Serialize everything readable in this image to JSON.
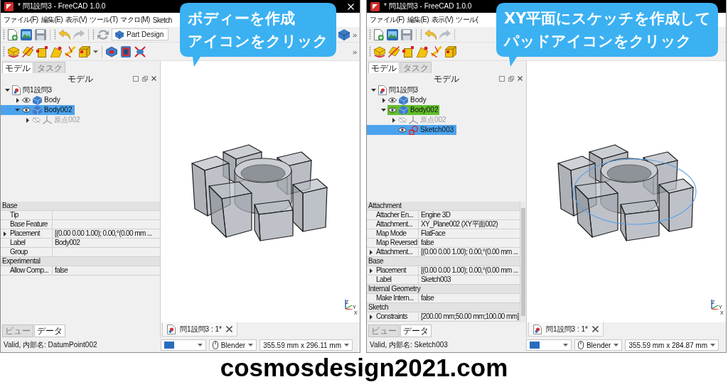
{
  "windows": [
    {
      "title": "* 問1設問3 - FreeCAD 1.0.0",
      "menu": [
        "ファイル(F)",
        "編集(E)",
        "表示(V)",
        "ツール(T)",
        "マクロ(M)",
        "Sketch"
      ],
      "workbench": "Part Design",
      "toolbar_overflow": [
        "»",
        "»"
      ],
      "callout": {
        "lines": [
          "ボディーを作成",
          "アイコンをクリック"
        ]
      },
      "panel_tabs": [
        {
          "label": "モデル",
          "selected": true
        },
        {
          "label": "タスク",
          "selected": false
        }
      ],
      "panel_title": "モデル",
      "tree": [
        {
          "label": "問1設問3",
          "kind": "document",
          "expandable": true,
          "expanded": true,
          "selected": false,
          "active": false,
          "children": [
            {
              "label": "Body",
              "kind": "body",
              "expandable": true,
              "expanded": false,
              "visible": true,
              "selected": false,
              "active": false
            },
            {
              "label": "Body002",
              "kind": "body",
              "expandable": true,
              "expanded": true,
              "visible": true,
              "selected": true,
              "active": false,
              "children": [
                {
                  "label": "原点002",
                  "kind": "origin",
                  "expandable": true,
                  "expanded": false,
                  "visible": false,
                  "selected": false,
                  "active": false
                }
              ]
            }
          ]
        }
      ],
      "properties": [
        {
          "kind": "group",
          "label": "Base"
        },
        {
          "kind": "property",
          "name": "Tip",
          "expander": false
        },
        {
          "kind": "property",
          "name": "Base Feature",
          "expander": false
        },
        {
          "kind": "property",
          "name": "Placement",
          "value": "[(0.00 0.00 1.00); 0.00,°(0.00 mm ...",
          "expander": true
        },
        {
          "kind": "property",
          "name": "Label",
          "value": "Body002",
          "expander": false
        },
        {
          "kind": "property",
          "name": "Group",
          "expander": false
        },
        {
          "kind": "group",
          "label": "Experimental"
        },
        {
          "kind": "property",
          "name": "Allow Comp...",
          "value": "false",
          "expander": false
        }
      ],
      "properties_scrollbar": false,
      "view": {
        "sketch_circle": false,
        "axes": [
          "Z",
          "Y",
          "X"
        ]
      },
      "bottom_tabs": [
        {
          "label": "ビュー",
          "selected": false
        },
        {
          "label": "データ",
          "selected": true
        }
      ],
      "document_tab": "問1設問3 : 1*",
      "status": {
        "message": "Valid, 内部名: DatumPoint002",
        "navigation": "Blender",
        "dimensions": "355.59 mm x 296.11 mm"
      }
    },
    {
      "title": "* 問1設問3 - FreeCAD 1.0.0",
      "menu": [
        "ファイル(F)",
        "編集(E)",
        "表示(V)",
        "ツール("
      ],
      "callout": {
        "lines": [
          "XY平面にスケッチを作成して",
          "パッドアイコンをクリック"
        ]
      },
      "panel_tabs": [
        {
          "label": "モデル",
          "selected": true
        },
        {
          "label": "タスク",
          "selected": false
        }
      ],
      "panel_title": "モデル",
      "tree": [
        {
          "label": "問1設問3",
          "kind": "document",
          "expandable": true,
          "expanded": true,
          "selected": false,
          "active": false,
          "children": [
            {
              "label": "Body",
              "kind": "body",
              "expandable": true,
              "expanded": false,
              "visible": true,
              "selected": false,
              "active": false
            },
            {
              "label": "Body002",
              "kind": "body",
              "expandable": true,
              "expanded": true,
              "visible": true,
              "selected": false,
              "active": true,
              "children": [
                {
                  "label": "原点002",
                  "kind": "origin",
                  "expandable": true,
                  "expanded": false,
                  "visible": false,
                  "selected": false,
                  "active": false
                },
                {
                  "label": "Sketch003",
                  "kind": "sketch",
                  "expandable": false,
                  "visible": true,
                  "selected": true,
                  "active": false
                }
              ]
            }
          ]
        }
      ],
      "properties": [
        {
          "kind": "group",
          "label": "Attachment"
        },
        {
          "kind": "property",
          "name": "Attacher En...",
          "value": "Engine 3D",
          "expander": false
        },
        {
          "kind": "property",
          "name": "Attachment...",
          "value": "XY_Plane002 (XY平面002)",
          "expander": false
        },
        {
          "kind": "property",
          "name": "Map Mode",
          "value": "FlatFace",
          "expander": false
        },
        {
          "kind": "property",
          "name": "Map Reversed",
          "value": "false",
          "expander": false
        },
        {
          "kind": "property",
          "name": "Attachment...",
          "value": "[(0.00 0.00 1.00); 0.00,°(0.00 mm ...",
          "expander": true
        },
        {
          "kind": "group",
          "label": "Base"
        },
        {
          "kind": "property",
          "name": "Placement",
          "value": "[(0.00 0.00 1.00); 0.00,°(0.00 mm ...",
          "expander": true
        },
        {
          "kind": "property",
          "name": "Label",
          "value": "Sketch003",
          "expander": false
        },
        {
          "kind": "group",
          "label": "Internal Geometry"
        },
        {
          "kind": "property",
          "name": "Make Intern...",
          "value": "false",
          "expander": false
        },
        {
          "kind": "group",
          "label": "Sketch"
        },
        {
          "kind": "property",
          "name": "Constraints",
          "value": "[200.00 mm;50.00 mm;100.00 mm]",
          "expander": true
        }
      ],
      "properties_scrollbar": true,
      "view": {
        "sketch_circle": true,
        "axes": [
          "Z",
          "Y",
          "X"
        ]
      },
      "bottom_tabs": [
        {
          "label": "ビュー",
          "selected": false
        },
        {
          "label": "データ",
          "selected": true
        }
      ],
      "document_tab": "問1設問3 : 1*",
      "status": {
        "message": "Valid, 内部名: Sketch003",
        "navigation": "Blender",
        "dimensions": "355.59 mm x 284.87 mm"
      }
    }
  ],
  "caption": "cosmosdesign2021.com"
}
